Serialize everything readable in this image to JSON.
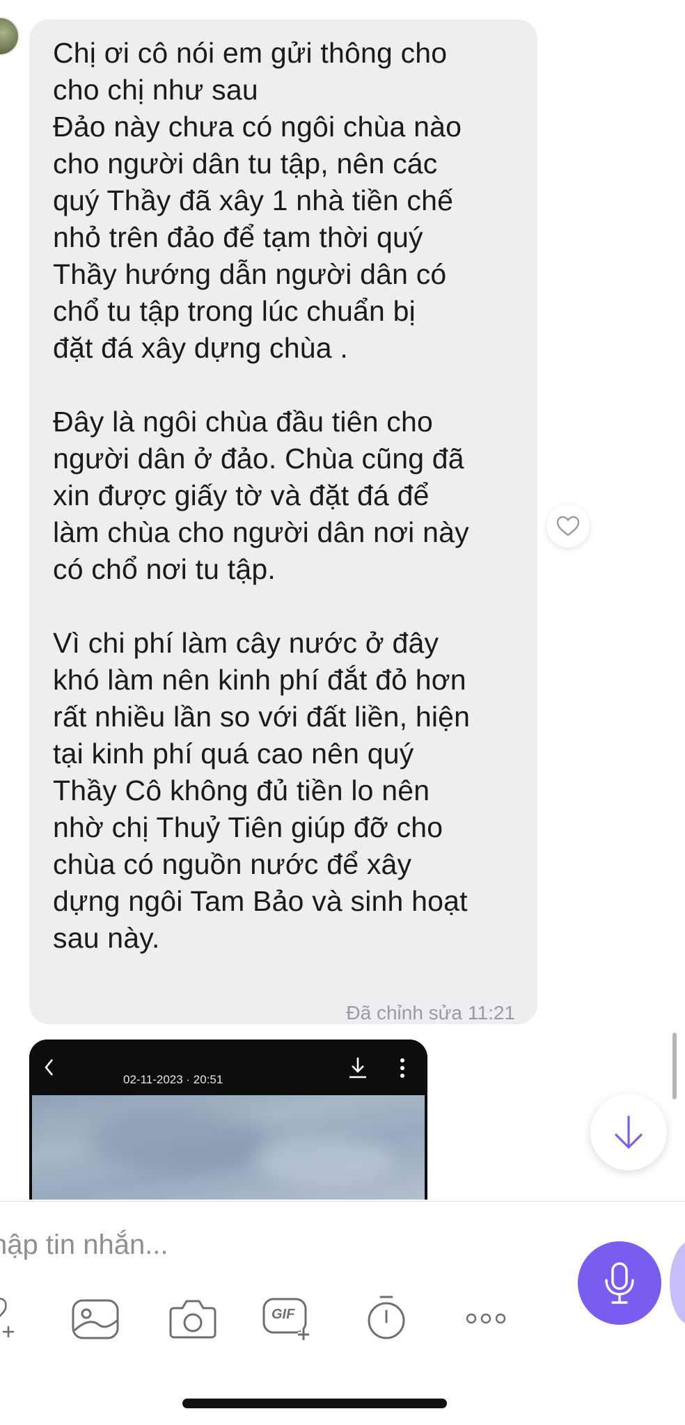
{
  "message": {
    "text": "Chị ơi cô nói em gửi thông cho\ncho chị như sau\nĐảo này chưa có ngôi chùa nào\ncho người dân tu tập, nên các\nquý Thầy đã xây 1 nhà tiền chế\nnhỏ trên đảo để tạm thời quý\nThầy hướng dẫn người dân có\nchổ tu tập trong lúc chuẩn bị\nđặt đá xây dựng chùa .\n\nĐây là ngôi chùa đầu tiên cho\nngười dân ở đảo. Chùa cũng đã\nxin được giấy tờ và đặt đá để\nlàm chùa cho người dân nơi này\ncó chổ nơi tu tập.\n\nVì chi phí làm cây nước ở đây\nkhó làm nên kinh phí đắt đỏ hơn\nrất nhiều lần so với đất liền, hiện\ntại kinh phí quá cao nên quý\nThầy Cô không đủ tiền lo nên\nnhờ chị Thuỷ Tiên giúp đỡ cho\nchùa có nguồn nước để xây\ndựng ngôi Tam Bảo và sinh hoạt\nsau này.",
    "edited_label": "Đã chỉnh sửa",
    "time": "11:21"
  },
  "image_message": {
    "date_time": "02-11-2023 · 20:51"
  },
  "composer": {
    "placeholder": "hập tin nhắn..."
  },
  "toolbar": {
    "gif_label": "GIF"
  },
  "colors": {
    "accent": "#7b5cf0",
    "bubble": "#eeeef0",
    "meta_text": "#9a9aa2"
  }
}
